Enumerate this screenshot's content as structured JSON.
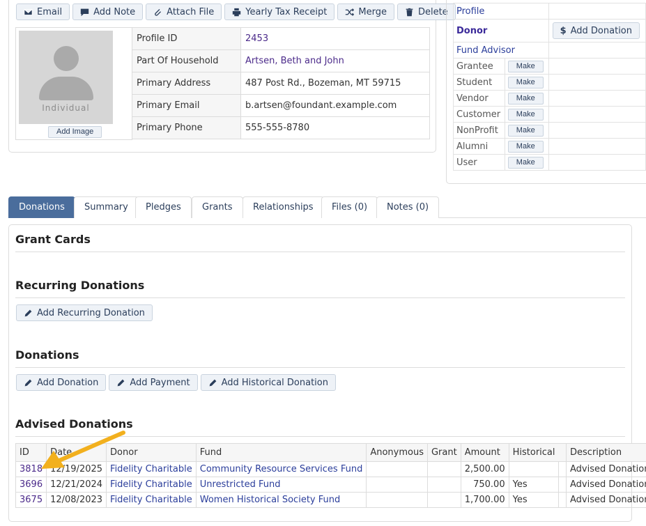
{
  "toolbar": {
    "email": "Email",
    "add_note": "Add Note",
    "attach_file": "Attach File",
    "yearly_tax_receipt": "Yearly Tax Receipt",
    "merge": "Merge",
    "delete": "Delete"
  },
  "photo": {
    "label": "Individual",
    "add_image": "Add Image"
  },
  "profile": [
    {
      "key": "Profile ID",
      "value": "2453"
    },
    {
      "key": "Part Of Household",
      "value": "Artsen, Beth and John"
    },
    {
      "key": "Primary Address",
      "value": "487 Post Rd., Bozeman, MT 59715"
    },
    {
      "key": "Primary Email",
      "value": "b.artsen@foundant.example.com"
    },
    {
      "key": "Primary Phone",
      "value": "555-555-8780"
    }
  ],
  "roles": {
    "profile": "Profile",
    "donor": "Donor",
    "add_donation": "Add Donation",
    "fund_advisor": "Fund Advisor",
    "make_label": "Make",
    "items": [
      "Grantee",
      "Student",
      "Vendor",
      "Customer",
      "NonProfit",
      "Alumni",
      "User"
    ]
  },
  "tabs": [
    "Donations",
    "Summary",
    "Pledges",
    "Grants",
    "Relationships",
    "Files (0)",
    "Notes (0)"
  ],
  "sections": {
    "grant_cards": "Grant Cards",
    "recurring": "Recurring Donations",
    "add_recurring": "Add Recurring Donation",
    "donations": "Donations",
    "add_donation": "Add Donation",
    "add_payment": "Add Payment",
    "add_historical": "Add Historical Donation",
    "advised": "Advised Donations"
  },
  "advised_table": {
    "headers": [
      "ID",
      "Date",
      "Donor",
      "Fund",
      "Anonymous",
      "Grant",
      "Amount",
      "Historical",
      "",
      "Description"
    ],
    "rows": [
      {
        "id": "3818",
        "date": "12/19/2025",
        "donor": "Fidelity Charitable",
        "fund": "Community Resource Services Fund",
        "anonymous": "",
        "grant": "",
        "amount": "2,500.00",
        "historical": "",
        "extra": "",
        "description": "Advised Donation"
      },
      {
        "id": "3696",
        "date": "12/21/2024",
        "donor": "Fidelity Charitable",
        "fund": "Unrestricted Fund",
        "anonymous": "",
        "grant": "",
        "amount": "750.00",
        "historical": "Yes",
        "extra": "",
        "description": "Advised Donation"
      },
      {
        "id": "3675",
        "date": "12/08/2023",
        "donor": "Fidelity Charitable",
        "fund": "Women Historical Society Fund",
        "anonymous": "",
        "grant": "",
        "amount": "1,700.00",
        "historical": "Yes",
        "extra": "",
        "description": "Advised Donation"
      }
    ]
  },
  "colors": {
    "accent": "#4a6d9c",
    "link": "#4b2a8a",
    "arrow": "#f2b01e"
  }
}
